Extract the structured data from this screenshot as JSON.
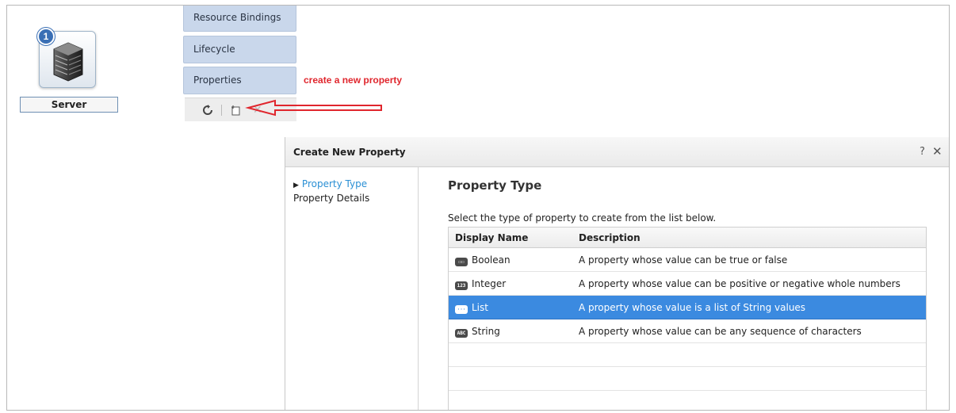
{
  "server": {
    "badge": "1",
    "label": "Server"
  },
  "side_tabs": [
    "Resource Bindings",
    "Lifecycle",
    "Properties"
  ],
  "toolbar": {
    "refresh_icon": "refresh-icon",
    "new_icon": "new-item-icon",
    "delete_icon": "delete-icon"
  },
  "annotation": {
    "text": "create a new property",
    "color": "#e0262d"
  },
  "dialog": {
    "title": "Create New Property",
    "help_glyph": "?",
    "close_glyph": "✕",
    "steps": [
      {
        "label": "Property Type",
        "active": true
      },
      {
        "label": "Property Details",
        "active": false
      }
    ],
    "content_title": "Property Type",
    "description": "Select the type of property to create from the list below.",
    "table": {
      "headers": [
        "Display Name",
        "Description"
      ],
      "rows": [
        {
          "icon": "boolean-icon",
          "badge": "☐☐",
          "name": "Boolean",
          "description": "A property whose value can be true or false",
          "selected": false
        },
        {
          "icon": "integer-icon",
          "badge": "123",
          "name": "Integer",
          "description": "A property whose value can be positive or negative whole numbers",
          "selected": false
        },
        {
          "icon": "list-icon",
          "badge": "···",
          "name": "List",
          "description": "A property whose value is a list of String values",
          "selected": true
        },
        {
          "icon": "string-icon",
          "badge": "ABC",
          "name": "String",
          "description": "A property whose value can be any sequence of characters",
          "selected": false
        }
      ]
    }
  },
  "colors": {
    "accent": "#3b8ae0",
    "tab_bg": "#c9d7eb",
    "active_step": "#2a8fd4"
  }
}
